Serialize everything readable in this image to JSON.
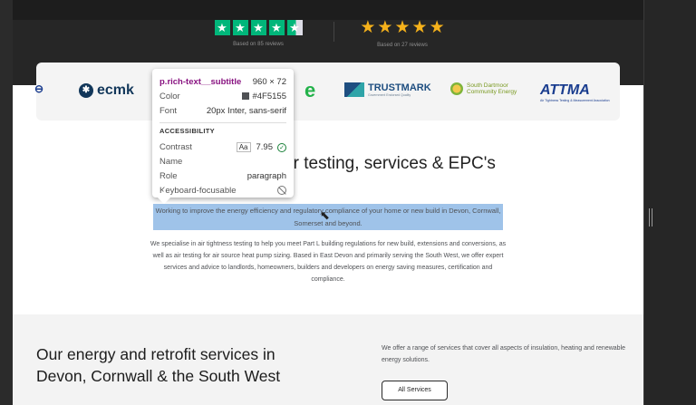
{
  "reviews": [
    {
      "provider": "trustpilot",
      "rating": 4.5,
      "max": 5,
      "note": "Based on 85 reviews"
    },
    {
      "provider": "google",
      "rating": 5,
      "max": 5,
      "note": "Based on 27 reviews"
    }
  ],
  "logos": {
    "ecmk": "ecmk",
    "ee": "e",
    "trustmark": "TRUSTMARK",
    "trustmark_sub": "Government Endorsed Quality",
    "south_dartmoor": "South Dartmoor Community Energy",
    "attma": "ATTMA",
    "attma_sub": "Air Tightness Testing & Measurement Association"
  },
  "heading_visible": "st experts in air testing, services & EPC's",
  "subtitle": "Working to improve the energy efficiency and regulatory compliance of your home or new build in Devon, Cornwall, Somerset and beyond.",
  "body": "We specialise in air tightness testing to help you meet Part L building regulations for new build, extensions and conversions, as well as air testing for air source heat pump sizing. Based in East Devon and primarily serving the South West, we offer expert services and advice to landlords, homeowners, builders and developers on energy saving measures, certification and compliance.",
  "services": {
    "title": "Our energy and retrofit services in Devon, Cornwall & the South West",
    "desc": "We offer a range of services that cover all aspects of insulation, heating and renewable energy solutions.",
    "button": "All Services"
  },
  "inspector": {
    "selector": "p.rich-text__subtitle",
    "dimensions": "960 × 72",
    "color_label": "Color",
    "color_value": "#4F5155",
    "font_label": "Font",
    "font_value": "20px Inter, sans-serif",
    "section": "ACCESSIBILITY",
    "contrast_label": "Contrast",
    "contrast_value": "7.95",
    "name_label": "Name",
    "role_label": "Role",
    "role_value": "paragraph",
    "keyboard_label": "Keyboard-focusable"
  },
  "colors": {
    "trustpilot_green": "#00b67a",
    "google_star": "#f6b21b",
    "text": "#4f5155",
    "highlight": "#9fc3e9"
  }
}
